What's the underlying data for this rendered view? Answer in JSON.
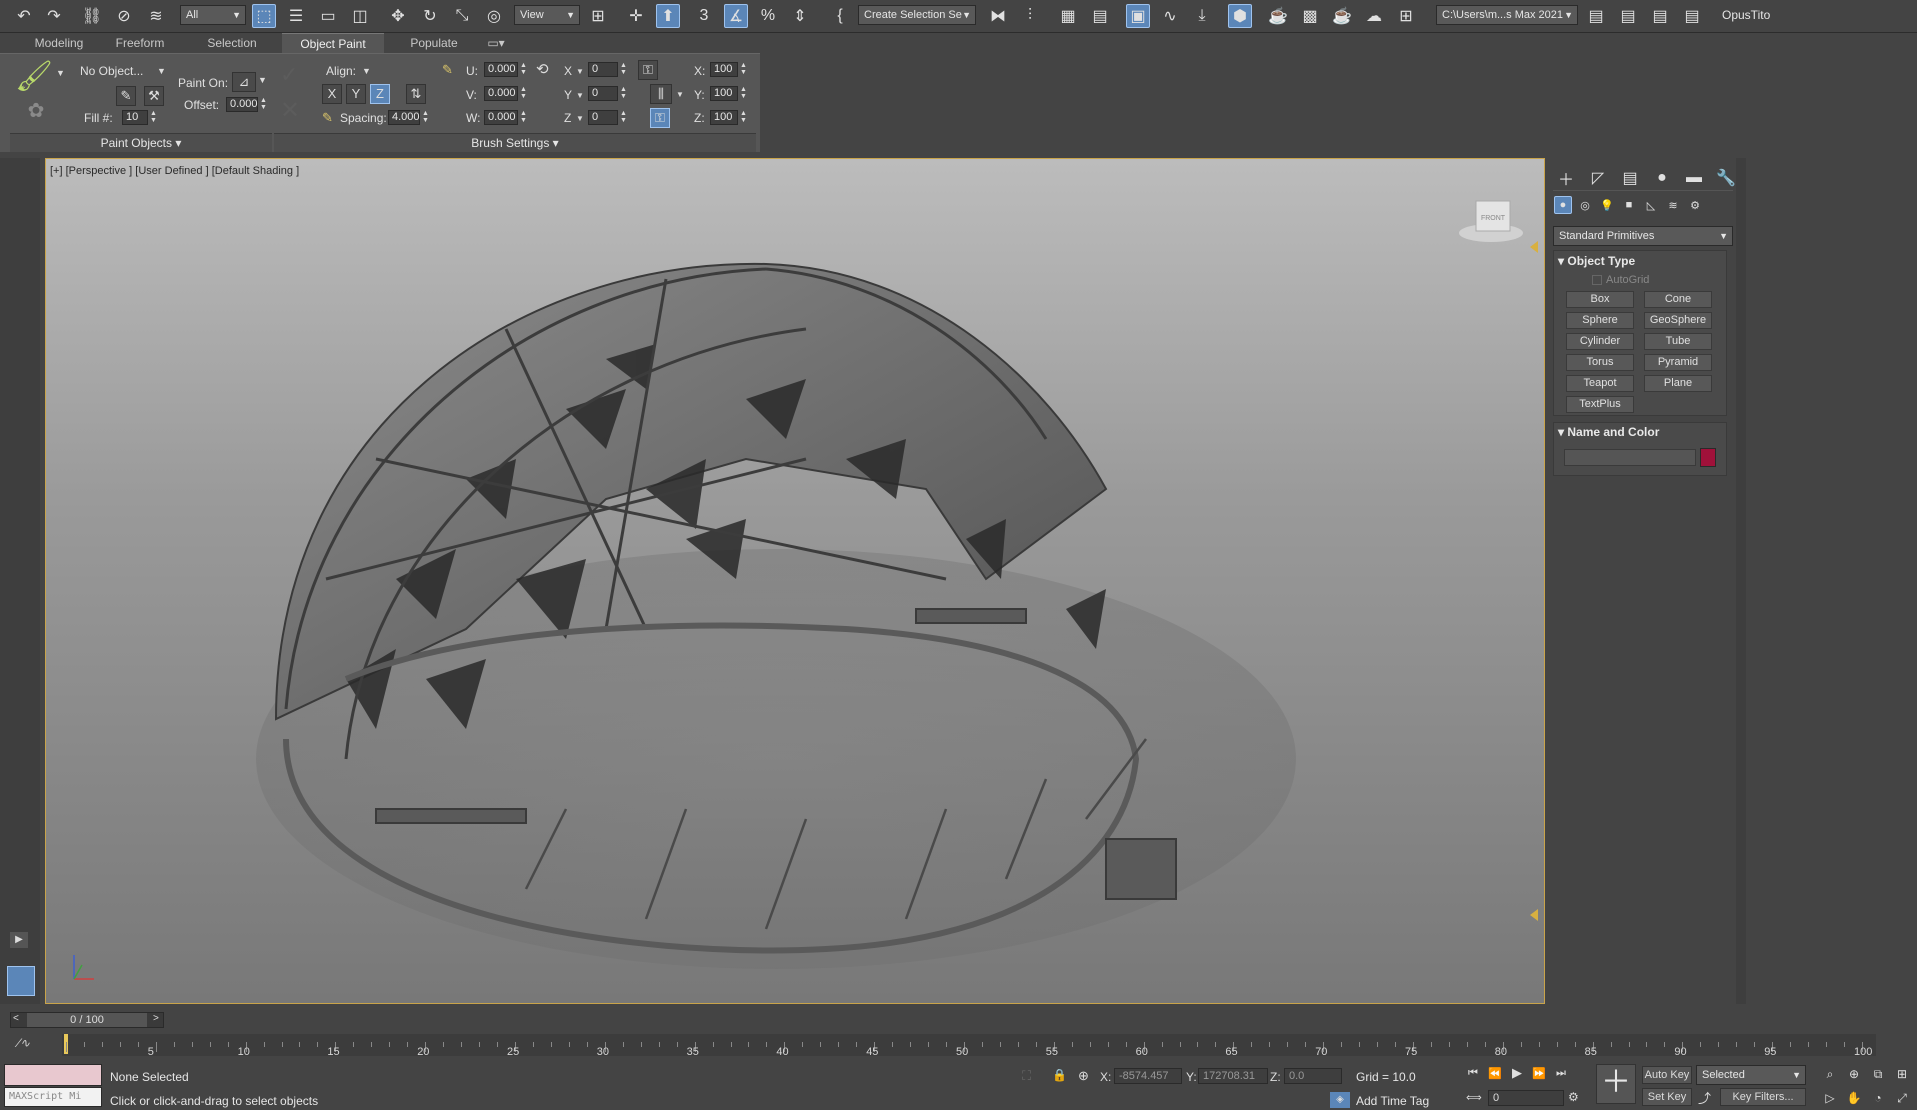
{
  "toolbar": {
    "selection_filter": "All",
    "ref_coord": "View",
    "named_selection": "Create Selection Se",
    "project_path": "C:\\Users\\m...s Max 2021",
    "user": "OpusTito"
  },
  "ribbon": {
    "tabs": [
      "Modeling",
      "Freeform",
      "Selection",
      "Object Paint",
      "Populate"
    ],
    "active_tab": "Object Paint",
    "paint_object": "No Object...",
    "fill_label": "Fill #:",
    "fill_value": "10",
    "paint_on_label": "Paint On:",
    "offset_label": "Offset:",
    "offset_value": "0.000",
    "align_label": "Align:",
    "axes": [
      "X",
      "Y",
      "Z"
    ],
    "spacing_label": "Spacing:",
    "spacing_value": "4.000",
    "u_label": "U:",
    "u_value": "0.000",
    "v_label": "V:",
    "v_value": "0.000",
    "w_label": "W:",
    "w_value": "0.000",
    "rx_label": "X",
    "rx_value": "0",
    "ry_label": "Y",
    "ry_value": "0",
    "rz_label": "Z",
    "rz_value": "0",
    "sx_label": "X:",
    "sx_value": "100",
    "sy_label": "Y:",
    "sy_value": "100",
    "sz_label": "Z:",
    "sz_value": "100",
    "group_paint_objects": "Paint Objects",
    "group_brush_settings": "Brush Settings"
  },
  "viewport": {
    "label": "[+] [Perspective ] [User Defined ] [Default Shading ]",
    "viewcube_face": "FRONT"
  },
  "command_panel": {
    "category": "Standard Primitives",
    "object_type_title": "Object Type",
    "autogrid": "AutoGrid",
    "primitives": [
      "Box",
      "Cone",
      "Sphere",
      "GeoSphere",
      "Cylinder",
      "Tube",
      "Torus",
      "Pyramid",
      "Teapot",
      "Plane",
      "TextPlus"
    ],
    "name_color_title": "Name and Color",
    "object_color": "#a0113a"
  },
  "timeline": {
    "frame_display": "0 / 100",
    "ticks": [
      "5",
      "10",
      "15",
      "20",
      "25",
      "30",
      "35",
      "40",
      "45",
      "50",
      "55",
      "60",
      "65",
      "70",
      "75",
      "80",
      "85",
      "90",
      "95",
      "100"
    ]
  },
  "status": {
    "maxscript": "MAXScript Mi",
    "selection": "None Selected",
    "prompt": "Click or click-and-drag to select objects",
    "x_label": "X:",
    "x_value": "-8574.457",
    "y_label": "Y:",
    "y_value": "172708.31",
    "z_label": "Z:",
    "z_value": "0.0",
    "grid": "Grid = 10.0",
    "add_time_tag": "Add Time Tag",
    "auto_key": "Auto Key",
    "key_mode": "Selected",
    "set_key": "Set Key",
    "key_filters": "Key Filters...",
    "current_frame": "0"
  }
}
